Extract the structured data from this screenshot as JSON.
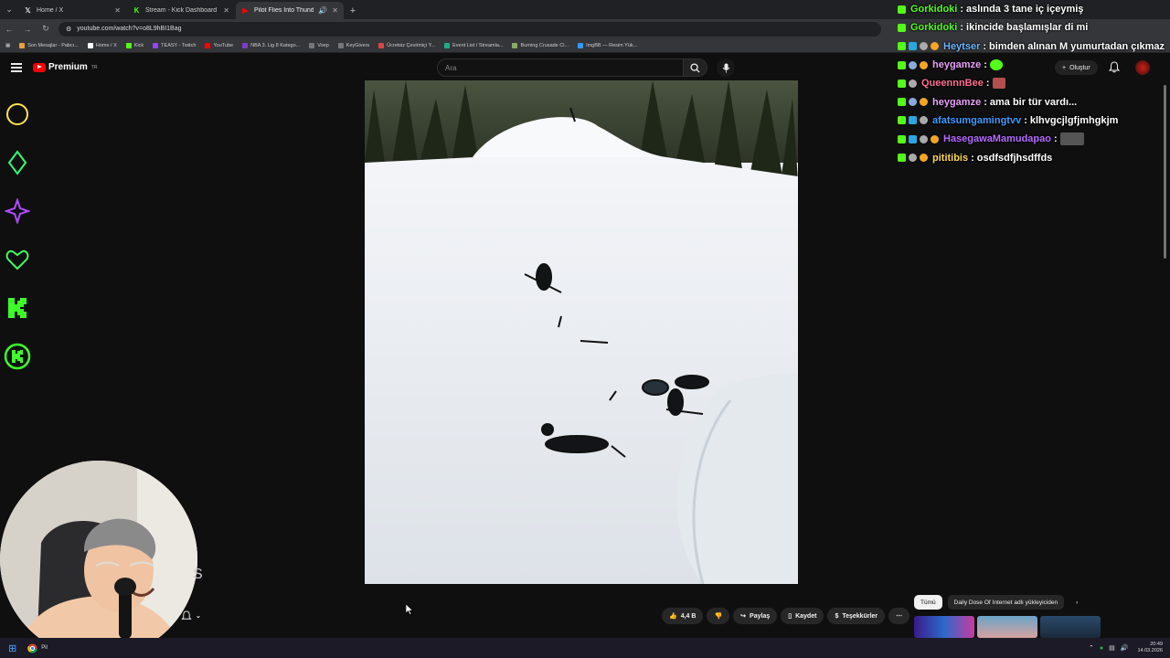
{
  "browser": {
    "tabs": [
      {
        "label": "Home / X",
        "icon": "x-icon",
        "active": false
      },
      {
        "label": "Stream - Kick Dashboard",
        "icon": "kick-icon",
        "active": false
      },
      {
        "label": "Pilot Flies Into Thunderstor",
        "icon": "youtube-icon",
        "active": true
      }
    ],
    "url": "youtube.com/watch?v=o8L9hBI1Bag",
    "bookmarks": [
      "Son Mesajlar - Pabcı...",
      "Home / X",
      "Kick",
      "TEASY - Twitch",
      "YouTube",
      "NBA 3. Lig 8 Katego...",
      "Voep",
      "KeyGivers",
      "Ücretsiz Çevrimiçi Y...",
      "Event List / Streamla...",
      "Burning Crusade Cl...",
      "ImgBB — Resim Yük..."
    ]
  },
  "youtube": {
    "logo_text": "Premium",
    "logo_sup": "TR",
    "search_placeholder": "Ara",
    "create_label": "Oluştur"
  },
  "chat": [
    {
      "user": "Gorkidoki",
      "text": "aslında 3 tane iç içeymiş",
      "color": "#53fc18",
      "badges": [
        "b-kick"
      ]
    },
    {
      "user": "Gorkidoki",
      "text": "ikincide başlamışlar di mi",
      "color": "#53fc18",
      "badges": [
        "b-kick"
      ]
    },
    {
      "user": "Heytser",
      "text": "bimden alınan M yumurtadan çıkmaz",
      "color": "#6ab7ff",
      "badges": [
        "b-kick",
        "b-blue",
        "b-grey",
        "b-gold"
      ]
    },
    {
      "user": "heygamze",
      "text": "",
      "color": "#e8a0f8",
      "badges": [
        "b-kick",
        "b-rocket",
        "b-gold"
      ],
      "emote": "#53fc18"
    },
    {
      "user": "QueennnBee",
      "text": "",
      "color": "#ff6f91",
      "badges": [
        "b-kick",
        "b-grey"
      ],
      "emote": "#b25050"
    },
    {
      "user": "heygamze",
      "text": "ama bir tür vardı...",
      "color": "#e8a0f8",
      "badges": [
        "b-kick",
        "b-rocket",
        "b-gold"
      ]
    },
    {
      "user": "afatsumgamingtvv",
      "text": "klhvgcjlgfjmhgkjm",
      "color": "#3b9bff",
      "badges": [
        "b-kick",
        "b-blue",
        "b-grey"
      ]
    },
    {
      "user": "HasegawaMamudapao",
      "text": "",
      "color": "#b46cff",
      "badges": [
        "b-kick",
        "b-blue",
        "b-grey",
        "b-gold"
      ],
      "emote": "#555"
    },
    {
      "user": "pititibis",
      "text": "osdfsdfjhsdffds",
      "color": "#ffd84a",
      "badges": [
        "b-kick",
        "b-grey",
        "b-gold"
      ]
    }
  ],
  "video_actions": {
    "likes": "4,4 B",
    "share": "Paylaş",
    "save": "Kaydet",
    "thanks": "Teşekkürler"
  },
  "chips": [
    "Tümü",
    "Daily Dose Of Internet adlı yükleyiciden"
  ],
  "taskbar": {
    "time": "20:49",
    "date": "14.03.2026",
    "app_label": "Pil"
  },
  "partial_text": "S"
}
